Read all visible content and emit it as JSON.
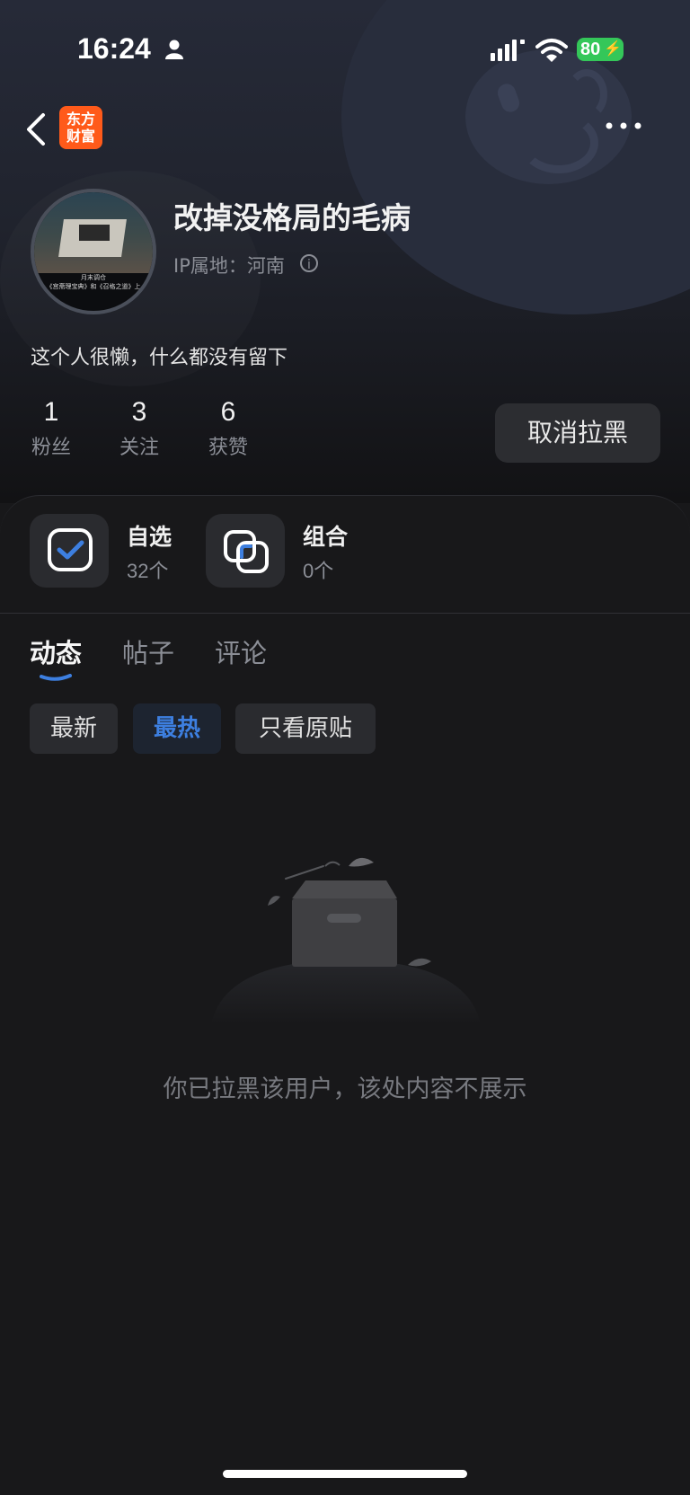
{
  "status_bar": {
    "time": "16:24",
    "battery": "80"
  },
  "nav": {
    "logo_line1": "东方",
    "logo_line2": "财富"
  },
  "profile": {
    "username": "改掉没格局的毛病",
    "ip_location": "IP属地：河南",
    "bio": "这个人很懒，什么都没有留下",
    "avatar_caption_line1": "月末调仓",
    "avatar_caption_line2": "《宫斋理宝典》和《召格之道》上"
  },
  "stats": [
    {
      "count": "1",
      "label": "粉丝"
    },
    {
      "count": "3",
      "label": "关注"
    },
    {
      "count": "6",
      "label": "获赞"
    }
  ],
  "unblock_label": "取消拉黑",
  "cards": [
    {
      "title": "自选",
      "sub": "32个",
      "icon": "checkbox-icon"
    },
    {
      "title": "组合",
      "sub": "0个",
      "icon": "overlap-squares-icon"
    }
  ],
  "tabs": [
    {
      "label": "动态",
      "active": true
    },
    {
      "label": "帖子",
      "active": false
    },
    {
      "label": "评论",
      "active": false
    }
  ],
  "filters": [
    {
      "label": "最新",
      "active": false
    },
    {
      "label": "最热",
      "active": true
    },
    {
      "label": "只看原贴",
      "active": false
    }
  ],
  "empty_message": "你已拉黑该用户，该处内容不展示",
  "colors": {
    "accent": "#3d7fe0",
    "logo": "#ff5a1a",
    "battery": "#34c759"
  }
}
